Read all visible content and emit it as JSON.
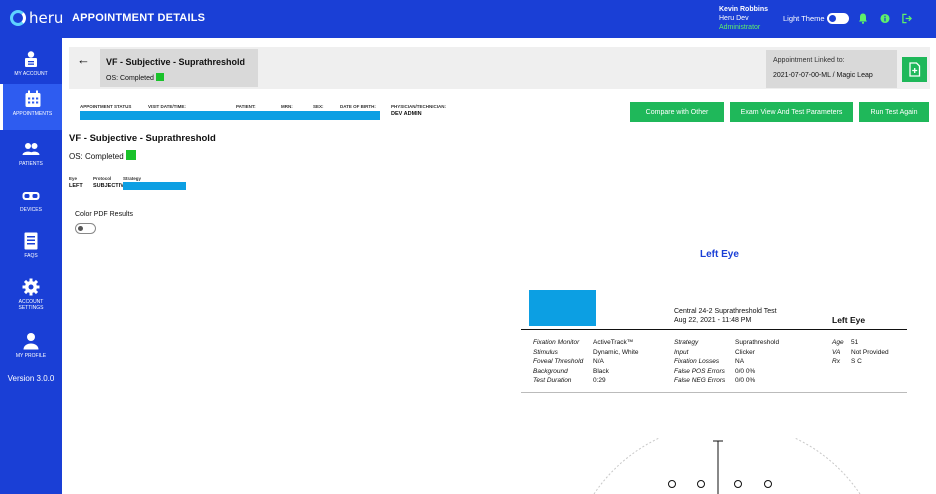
{
  "app": {
    "logo_text": "heru",
    "page_heading": "APPOINTMENT DETAILS"
  },
  "user": {
    "name": "Kevin Robbins",
    "org": "Heru Dev",
    "role": "Administrator",
    "theme_label": "Light Theme"
  },
  "sidebar": {
    "items": [
      {
        "label": "MY ACCOUNT",
        "icon": "user-badge-icon"
      },
      {
        "label": "APPOINTMENTS",
        "icon": "calendar-icon",
        "active": true
      },
      {
        "label": "PATIENTS",
        "icon": "patients-icon"
      },
      {
        "label": "DEVICES",
        "icon": "vr-headset-icon"
      },
      {
        "label": "FAQS",
        "icon": "document-icon"
      },
      {
        "label": "ACCOUNT SETTINGS",
        "icon": "gear-icon"
      },
      {
        "label": "MY PROFILE",
        "icon": "person-icon"
      }
    ],
    "version": "Version 3.0.0"
  },
  "header": {
    "title": "VF - Subjective - Suprathreshold",
    "status": "OS: Completed",
    "linked_label": "Appointment Linked to:",
    "linked_value": "2021-07-07-00-ML / Magic Leap"
  },
  "info": {
    "labels": [
      "APPOINTMENT STATUS",
      "VISIT DATE/TIME:",
      "PATIENT:",
      "MRN:",
      "SEX:",
      "DATE OF BIRTH:"
    ],
    "physician_label": "PHYSICIAN/TECHNICIAN:",
    "physician_value": "DEV ADMIN"
  },
  "actions": {
    "compare": "Compare with Other",
    "exam_view": "Exam View And Test Parameters",
    "run_again": "Run Test Again"
  },
  "section": {
    "title": "VF - Subjective - Suprathreshold",
    "status": "OS: Completed",
    "eye_label": "Eye",
    "eye_value": "LEFT",
    "protocol_label": "Protocol",
    "protocol_value": "SUBJECTIVE",
    "strategy_label": "Strategy",
    "pdf_label": "Color PDF Results"
  },
  "report": {
    "eye_heading": "Left Eye",
    "test_name": "Central 24-2 Suprathreshold Test",
    "test_date": "Aug 22, 2021 - 11:48 PM",
    "eye": "Left Eye",
    "col1": [
      [
        "Fixation Monitor",
        "ActiveTrack™"
      ],
      [
        "Stimulus",
        "Dynamic, White"
      ],
      [
        "Foveal Threshold",
        "N/A"
      ],
      [
        "Background",
        "Black"
      ],
      [
        "Test Duration",
        "0:29"
      ]
    ],
    "col2": [
      [
        "Strategy",
        "Suprathreshold"
      ],
      [
        "Input",
        "Clicker"
      ],
      [
        "Fixation Losses",
        "NA"
      ],
      [
        "False POS Errors",
        "0/0 0%"
      ],
      [
        "False NEG Errors",
        "0/0 0%"
      ]
    ],
    "col3": [
      [
        "Age",
        "51"
      ],
      [
        "VA",
        "Not Provided"
      ],
      [
        "Rx",
        "S  C"
      ]
    ]
  },
  "colors": {
    "brand": "#1a3fd6",
    "accent": "#1fb85a",
    "redacted": "#0c9fe3",
    "status_green": "#19c22a"
  }
}
